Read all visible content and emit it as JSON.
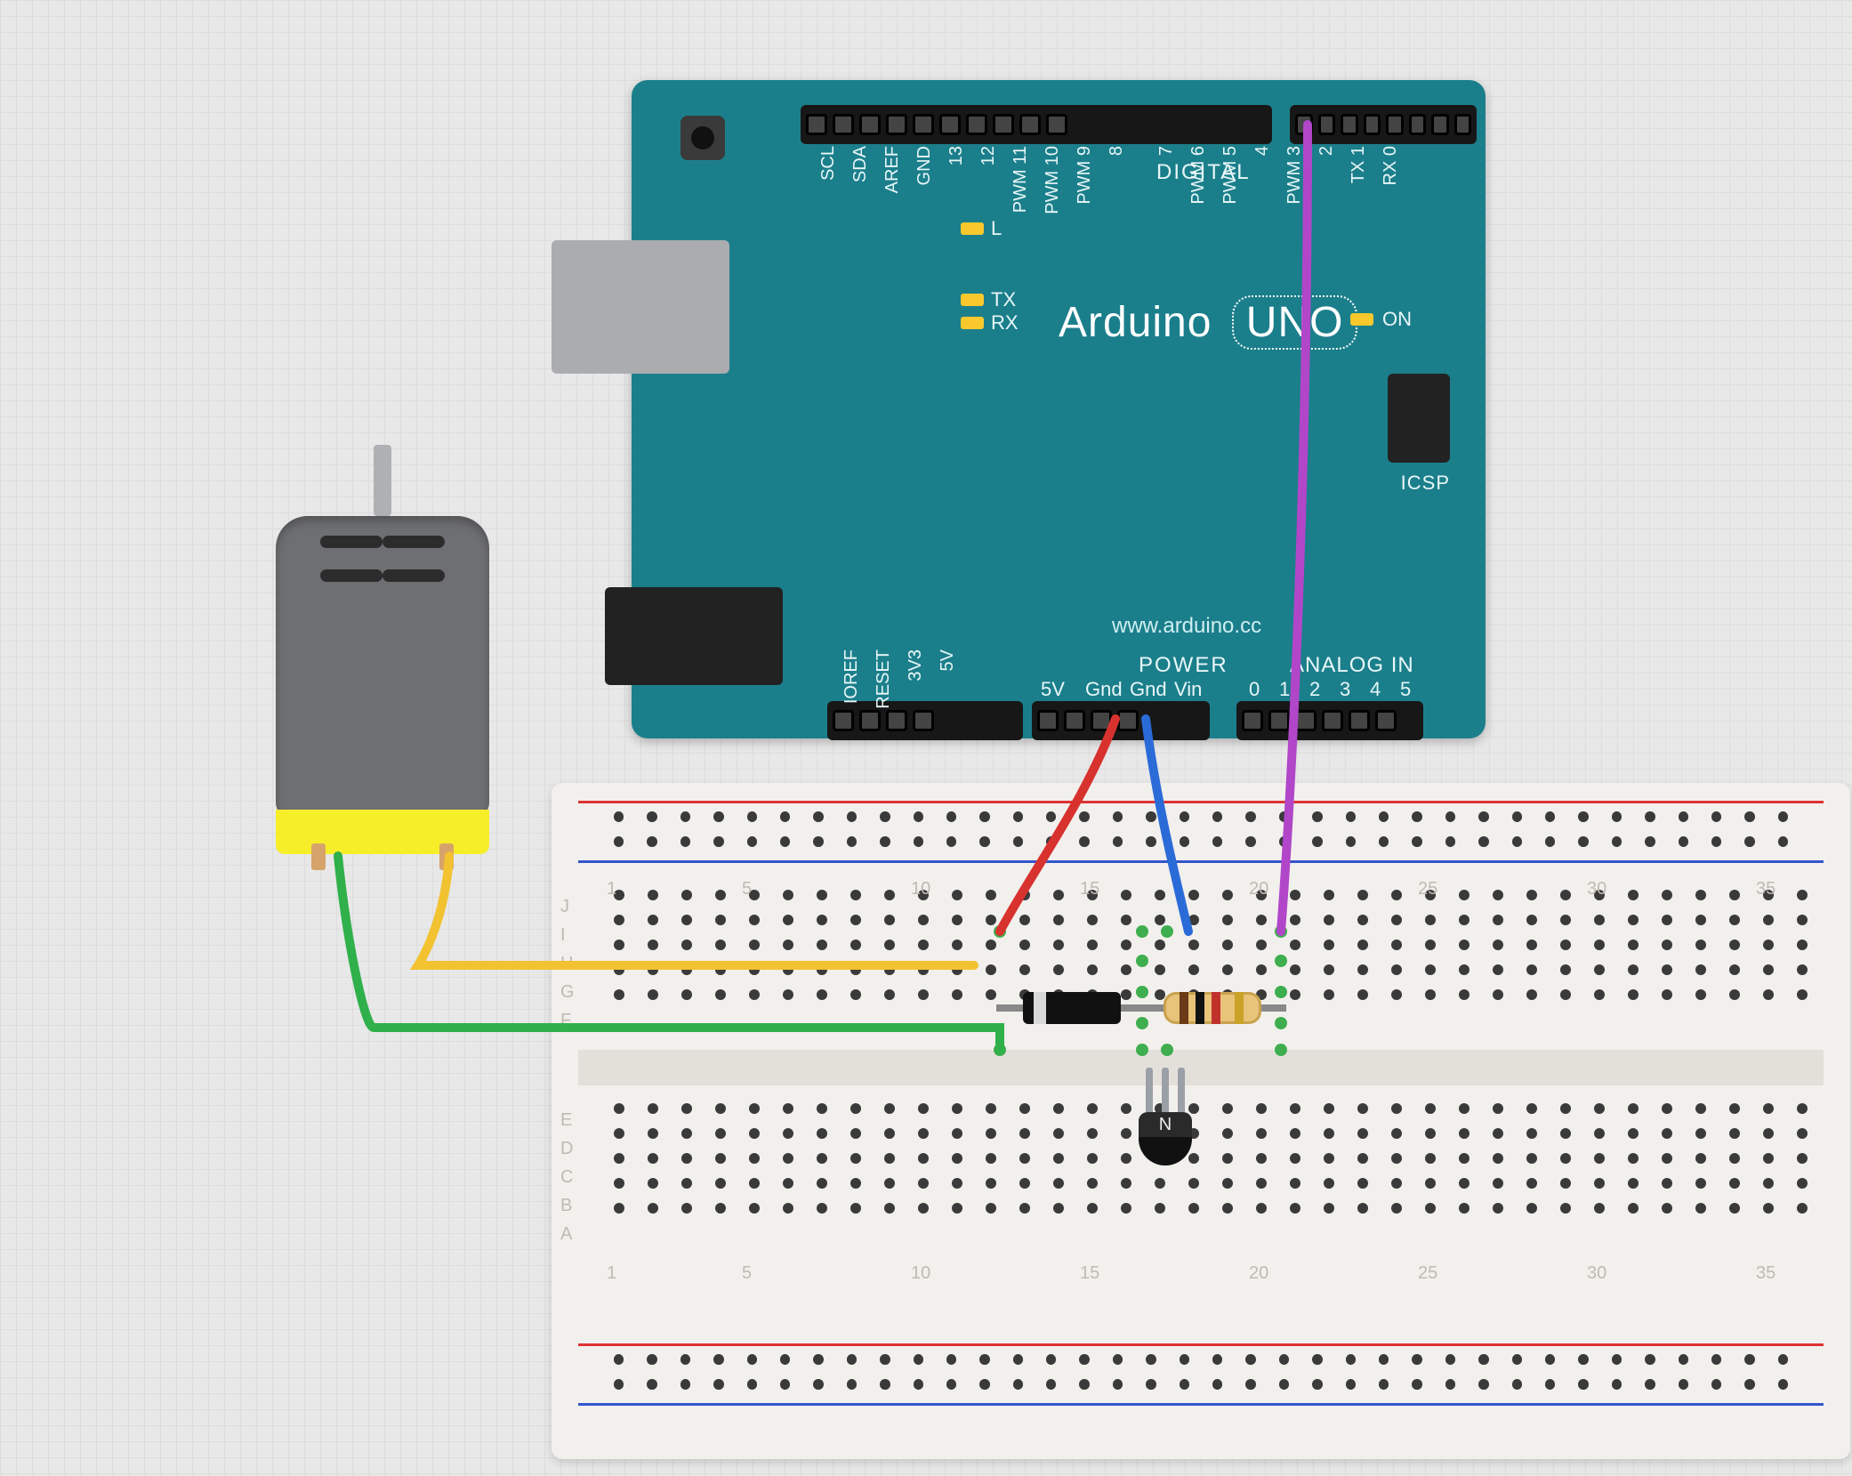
{
  "arduino": {
    "brand": "Arduino",
    "model": "UNO",
    "url": "www.arduino.cc",
    "labels": {
      "power": "POWER",
      "analog_in": "ANALOG IN",
      "digital": "DIGITAL",
      "icsp": "ICSP",
      "L": "L",
      "TX": "TX",
      "RX": "RX",
      "ON": "ON"
    },
    "pins_top": [
      "SCL",
      "SDA",
      "AREF",
      "GND",
      "13",
      "12",
      "PWM 11",
      "PWM 10",
      "PWM 9",
      "8",
      "7",
      "PWM 6",
      "PWM 5",
      "4",
      "PWM 3",
      "2",
      "TX 1",
      "RX 0"
    ],
    "pins_bottom_power": [
      "IOREF",
      "RESET",
      "3V3",
      "5V",
      "Gnd",
      "Gnd",
      "Vin"
    ],
    "pins_bottom_analog": [
      "0",
      "1",
      "2",
      "3",
      "4",
      "5"
    ]
  },
  "components": {
    "motor": {
      "name": "dc-motor"
    },
    "diode": {
      "name": "flyback-diode"
    },
    "resistor": {
      "name": "base-resistor",
      "bands": [
        "brown",
        "black",
        "red",
        "gold"
      ]
    },
    "transistor": {
      "name": "npn-transistor",
      "marking": "N"
    }
  },
  "wires": [
    {
      "name": "wire-5v-to-breadboard",
      "color": "#d8322e",
      "from": "arduino-5v",
      "to": "breadboard-col15-rowJ"
    },
    {
      "name": "wire-gnd-to-breadboard",
      "color": "#2b6bd8",
      "from": "arduino-gnd",
      "to": "breadboard-col20-rowJ"
    },
    {
      "name": "wire-d3-to-resistor",
      "color": "#b146c9",
      "from": "arduino-d3",
      "to": "breadboard-col23-rowJ"
    },
    {
      "name": "wire-motor-term1",
      "color": "#f2c230",
      "from": "motor-term-right",
      "to": "breadboard-col15-rowI"
    },
    {
      "name": "wire-motor-term2",
      "color": "#2fb04a",
      "from": "motor-term-left",
      "to": "breadboard-col15-rowF"
    }
  ],
  "breadboard": {
    "columns": [
      1,
      5,
      10,
      15,
      20,
      25,
      30,
      35
    ],
    "rows_top": [
      "J",
      "I",
      "H",
      "G",
      "F"
    ],
    "rows_bottom": [
      "E",
      "D",
      "C",
      "B",
      "A"
    ]
  }
}
